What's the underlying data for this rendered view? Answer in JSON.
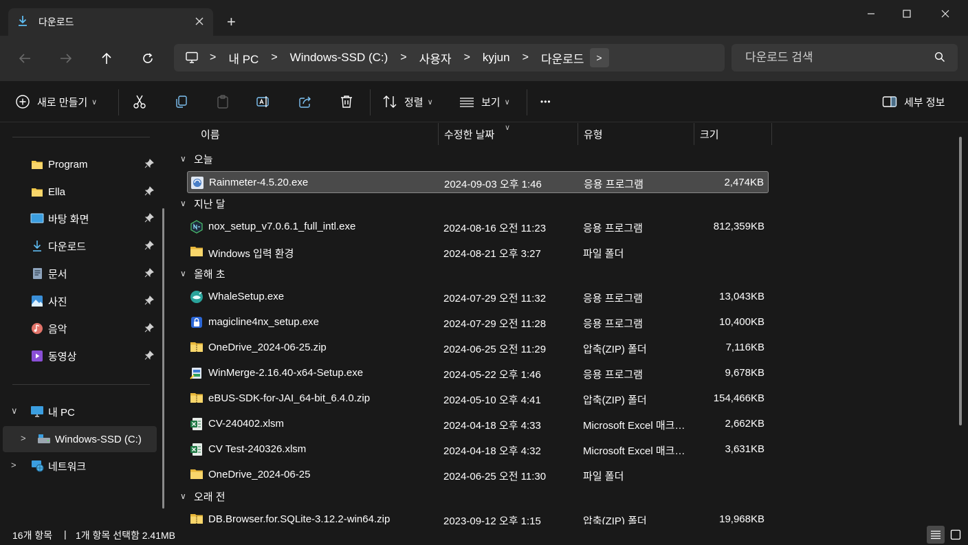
{
  "window": {
    "tab_title": "다운로드",
    "tab_icon": "download-icon",
    "new_tab_label": "+",
    "minimize_label": "—",
    "maximize_label": "☐",
    "close_label": "✕"
  },
  "address": {
    "breadcrumbs": [
      "내 PC",
      "Windows-SSD (C:)",
      "사용자",
      "kyjun",
      "다운로드"
    ],
    "separator": ">",
    "more_label": ">",
    "search_placeholder": "다운로드 검색"
  },
  "toolbar": {
    "new_label": "새로 만들기",
    "sort_label": "정렬",
    "view_label": "보기",
    "more_label": "•••",
    "details_label": "세부 정보"
  },
  "sidebar": {
    "quick_access": [
      {
        "label": "Program",
        "icon": "folder-icon"
      },
      {
        "label": "Ella",
        "icon": "folder-icon"
      },
      {
        "label": "바탕 화면",
        "icon": "desktop-icon"
      },
      {
        "label": "다운로드",
        "icon": "download-icon"
      },
      {
        "label": "문서",
        "icon": "document-icon"
      },
      {
        "label": "사진",
        "icon": "pictures-icon"
      },
      {
        "label": "음악",
        "icon": "music-icon"
      },
      {
        "label": "동영상",
        "icon": "video-icon"
      }
    ],
    "tree": [
      {
        "label": "내 PC",
        "expander": "∨",
        "icon": "pc-icon"
      },
      {
        "label": "Windows-SSD (C:)",
        "expander": ">",
        "icon": "drive-icon"
      },
      {
        "label": "네트워크",
        "expander": ">",
        "icon": "network-icon"
      }
    ]
  },
  "columns": {
    "name": "이름",
    "date": "수정한 날짜",
    "type": "유형",
    "size": "크기",
    "sort_indicator": "∨"
  },
  "groups": [
    {
      "label": "오늘",
      "files": [
        {
          "name": "Rainmeter-4.5.20.exe",
          "date": "2024-09-03 오후 1:46",
          "type": "응용 프로그램",
          "size": "2,474KB",
          "icon": "rainmeter-app-icon"
        }
      ]
    },
    {
      "label": "지난 달",
      "files": [
        {
          "name": "nox_setup_v7.0.6.1_full_intl.exe",
          "date": "2024-08-16 오전 11:23",
          "type": "응용 프로그램",
          "size": "812,359KB",
          "icon": "nox-app-icon"
        },
        {
          "name": "Windows 입력 환경",
          "date": "2024-08-21 오후 3:27",
          "type": "파일 폴더",
          "size": "",
          "icon": "folder-icon"
        }
      ]
    },
    {
      "label": "올해 초",
      "files": [
        {
          "name": "WhaleSetup.exe",
          "date": "2024-07-29 오전 11:32",
          "type": "응용 프로그램",
          "size": "13,043KB",
          "icon": "whale-app-icon"
        },
        {
          "name": "magicline4nx_setup.exe",
          "date": "2024-07-29 오전 11:28",
          "type": "응용 프로그램",
          "size": "10,400KB",
          "icon": "magicline-app-icon"
        },
        {
          "name": "OneDrive_2024-06-25.zip",
          "date": "2024-06-25 오전 11:29",
          "type": "압축(ZIP) 폴더",
          "size": "7,116KB",
          "icon": "zip-folder-icon"
        },
        {
          "name": "WinMerge-2.16.40-x64-Setup.exe",
          "date": "2024-05-22 오후 1:46",
          "type": "응용 프로그램",
          "size": "9,678KB",
          "icon": "setup-app-icon"
        },
        {
          "name": "eBUS-SDK-for-JAI_64-bit_6.4.0.zip",
          "date": "2024-05-10 오후 4:41",
          "type": "압축(ZIP) 폴더",
          "size": "154,466KB",
          "icon": "zip-folder-icon"
        },
        {
          "name": "CV-240402.xlsm",
          "date": "2024-04-18 오후 4:33",
          "type": "Microsoft Excel 매크로 사용 워크시트",
          "size": "2,662KB",
          "icon": "excel-file-icon"
        },
        {
          "name": "CV Test-240326.xlsm",
          "date": "2024-04-18 오후 4:32",
          "type": "Microsoft Excel 매크로 사용 워크시트",
          "size": "3,631KB",
          "icon": "excel-file-icon"
        },
        {
          "name": "OneDrive_2024-06-25",
          "date": "2024-06-25 오전 11:30",
          "type": "파일 폴더",
          "size": "",
          "icon": "folder-icon"
        }
      ]
    },
    {
      "label": "오래 전",
      "files": [
        {
          "name": "DB.Browser.for.SQLite-3.12.2-win64.zip",
          "date": "2023-09-12 오후 1:15",
          "type": "압축(ZIP) 폴더",
          "size": "19,968KB",
          "icon": "zip-folder-icon"
        }
      ]
    }
  ],
  "status": {
    "item_count": "16개 항목",
    "selection": "1개 항목 선택함 2.41MB",
    "separator": "|"
  },
  "colors": {
    "background": "#191919",
    "titlebar": "#202020",
    "toolbar_surface": "#2c2c2c",
    "accent_blue": "#5fbdf3",
    "folder_yellow": "#f3c94a",
    "selection": "#4a4a4a"
  }
}
